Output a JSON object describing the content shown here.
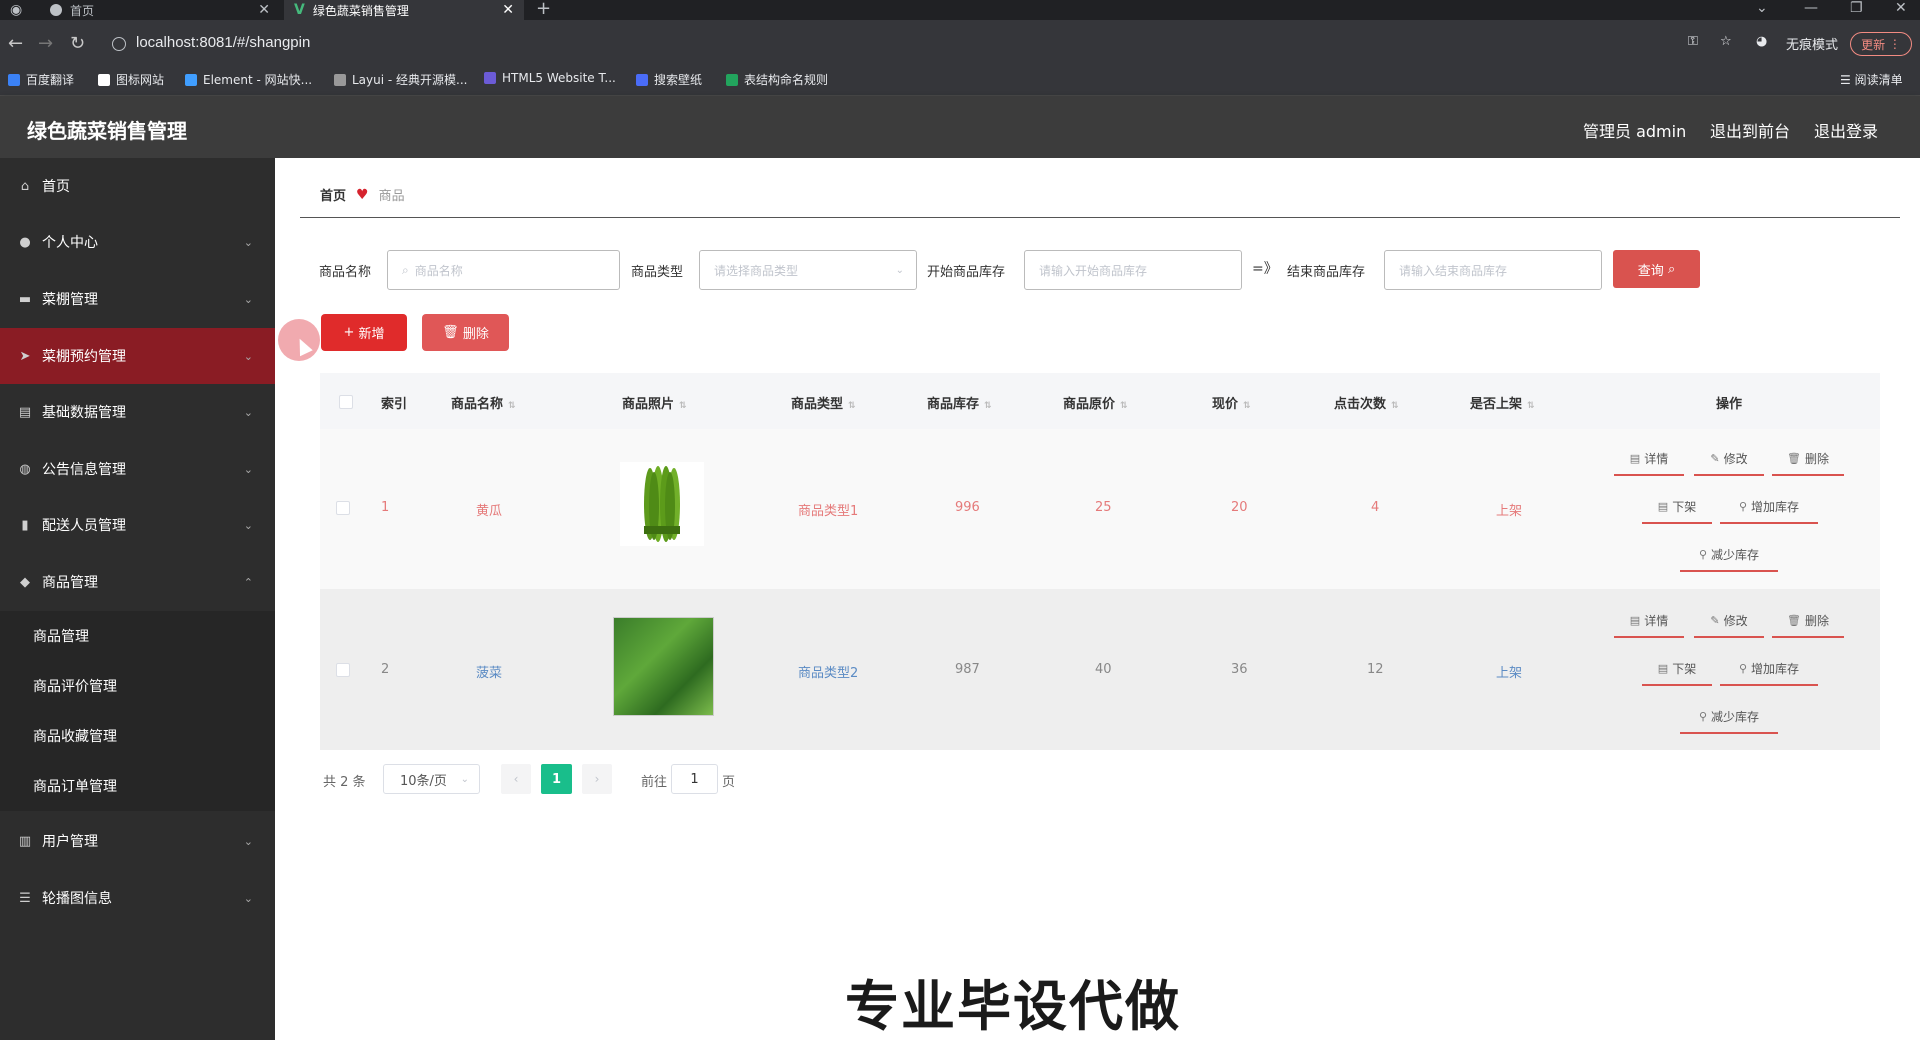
{
  "browser": {
    "tabs": [
      {
        "title": "首页"
      },
      {
        "title": "绿色蔬菜销售管理"
      }
    ],
    "url": "localhost:8081/#/shangpin",
    "profile": "无痕模式",
    "update_label": "更新",
    "bookmarks": [
      "百度翻译",
      "图标网站",
      "Element - 网站快...",
      "Layui - 经典开源模...",
      "HTML5 Website T...",
      "搜索壁纸",
      "表结构命名规则"
    ],
    "reading_list": "阅读清单"
  },
  "header": {
    "title": "绿色蔬菜销售管理",
    "user": "管理员 admin",
    "to_front": "退出到前台",
    "logout": "退出登录"
  },
  "sidebar": {
    "items": [
      {
        "label": "首页",
        "icon": "home-icon"
      },
      {
        "label": "个人中心",
        "icon": "user-icon"
      },
      {
        "label": "菜棚管理",
        "icon": "chat-icon"
      },
      {
        "label": "菜棚预约管理",
        "icon": "send-icon"
      },
      {
        "label": "基础数据管理",
        "icon": "clipboard-icon"
      },
      {
        "label": "公告信息管理",
        "icon": "globe-icon"
      },
      {
        "label": "配送人员管理",
        "icon": "bar-chart-icon"
      },
      {
        "label": "商品管理",
        "icon": "pin-icon"
      },
      {
        "label": "用户管理",
        "icon": "grid-icon"
      },
      {
        "label": "轮播图信息",
        "icon": "sliders-icon"
      }
    ],
    "sub_items": [
      "商品管理",
      "商品评价管理",
      "商品收藏管理",
      "商品订单管理"
    ]
  },
  "breadcrumb": {
    "home": "首页",
    "current": "商品"
  },
  "filters": {
    "name_label": "商品名称",
    "name_placeholder": "商品名称",
    "type_label": "商品类型",
    "type_placeholder": "请选择商品类型",
    "start_label": "开始商品库存",
    "start_placeholder": "请输入开始商品库存",
    "range_sep": "=》",
    "end_label": "结束商品库存",
    "end_placeholder": "请输入结束商品库存",
    "query_label": "查询"
  },
  "actions": {
    "add_label": "新增",
    "delete_label": "删除"
  },
  "table": {
    "headers": [
      "索引",
      "商品名称",
      "商品照片",
      "商品类型",
      "商品库存",
      "商品原价",
      "现价",
      "点击次数",
      "是否上架",
      "操作"
    ],
    "rows": [
      {
        "index": "1",
        "name": "黄瓜",
        "type": "商品类型1",
        "stock": "996",
        "original_price": "25",
        "price": "20",
        "clicks": "4",
        "on_shelf": "上架"
      },
      {
        "index": "2",
        "name": "菠菜",
        "type": "商品类型2",
        "stock": "987",
        "original_price": "40",
        "price": "36",
        "clicks": "12",
        "on_shelf": "上架"
      }
    ],
    "ops": {
      "detail": "详情",
      "edit": "修改",
      "delete": "删除",
      "off_shelf": "下架",
      "add_stock": "增加库存",
      "reduce_stock": "减少库存"
    }
  },
  "pagination": {
    "total": "共 2 条",
    "page_size": "10条/页",
    "current_page": "1",
    "goto_label": "前往",
    "goto_value": "1",
    "page_suffix": "页"
  },
  "watermark": "专业毕设代做",
  "colors": {
    "accent": "#d9534f",
    "sidebar": "#2d2d2d",
    "active_menu": "#8a1c24",
    "page_current": "#19be8b"
  }
}
